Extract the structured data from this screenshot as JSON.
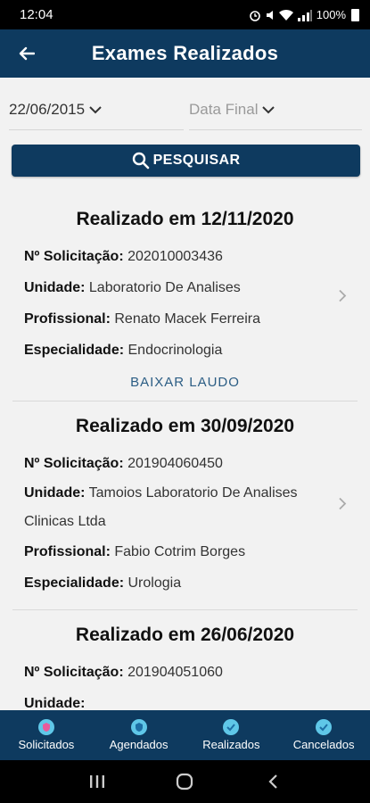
{
  "status_bar": {
    "time": "12:04",
    "battery": "100%"
  },
  "header": {
    "title": "Exames Realizados"
  },
  "filters": {
    "start_date": "22/06/2015",
    "end_date_placeholder": "Data Final"
  },
  "search_button": {
    "label": "PESQUISAR"
  },
  "labels": {
    "solicitacao": "Nº Solicitação:",
    "unidade": "Unidade:",
    "profissional": "Profissional:",
    "especialidade": "Especialidade:"
  },
  "exams": [
    {
      "title": "Realizado em 12/11/2020",
      "solicitacao": "202010003436",
      "unidade": "Laboratorio De Analises",
      "profissional": "Renato Macek Ferreira",
      "especialidade": "Endocrinologia",
      "download_label": "BAIXAR LAUDO"
    },
    {
      "title": "Realizado em 30/09/2020",
      "solicitacao": "201904060450",
      "unidade": "Tamoios Laboratorio De Analises Clinicas Ltda",
      "profissional": "Fabio Cotrim Borges",
      "especialidade": "Urologia"
    },
    {
      "title": "Realizado em 26/06/2020",
      "solicitacao": "201904051060",
      "unidade": ""
    }
  ],
  "bottom_nav": [
    {
      "label": "Solicitados",
      "icon": "shield-icon"
    },
    {
      "label": "Agendados",
      "icon": "shield-icon"
    },
    {
      "label": "Realizados",
      "icon": "shield-check-icon"
    },
    {
      "label": "Cancelados",
      "icon": "shield-check-icon"
    }
  ],
  "colors": {
    "primary": "#0e3a5f",
    "accent": "#5fc7e8",
    "link": "#2b5d84"
  }
}
